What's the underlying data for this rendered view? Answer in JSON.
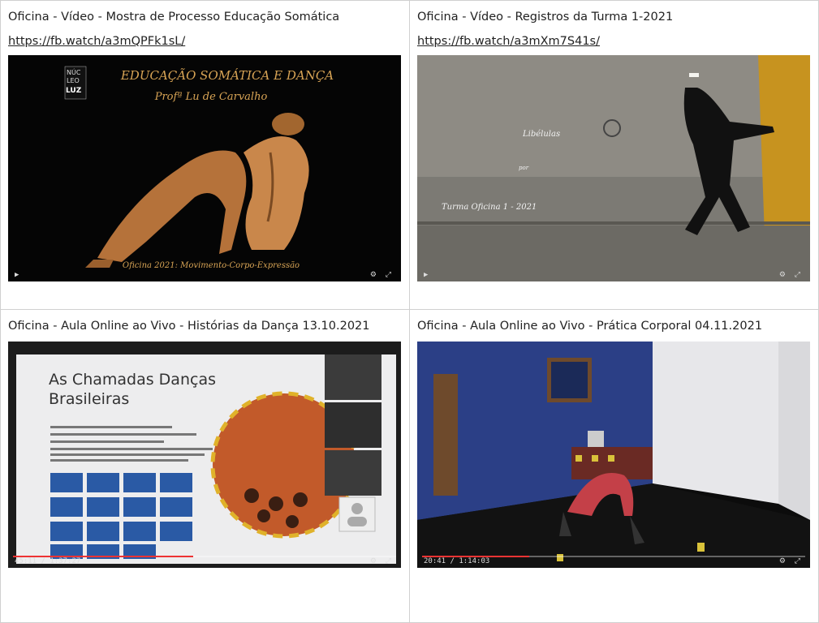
{
  "cells": [
    {
      "title": "Oficina - Vídeo - Mostra de Processo Educação Somática",
      "link": "https://fb.watch/a3mQPFk1sL/"
    },
    {
      "title": "Oficina - Vídeo - Registros da Turma 1-2021",
      "link": "https://fb.watch/a3mXm7S41s/"
    },
    {
      "title": "Oficina - Aula Online ao Vivo - Histórias da Dança 13.10.2021"
    },
    {
      "title": "Oficina - Aula Online ao Vivo - Prática Corporal 04.11.2021"
    }
  ],
  "thumb1": {
    "logo": [
      "NÚC",
      "LEO",
      "LUZ"
    ],
    "heading": "EDUCAÇÃO SOMÁTICA E DANÇA",
    "subheading": "Profª Lu de Carvalho",
    "footer": "Oficina 2021: Movimento-Corpo-Expressão"
  },
  "thumb2": {
    "line1": "Libélulas",
    "line2": "por",
    "line3": "Turma Oficina 1 - 2021"
  },
  "thumb3": {
    "slide_title": "As Chamadas Danças Brasileiras",
    "time": "45:11 / 1:37:27"
  },
  "thumb4": {
    "time": "20:41 / 1:14:03"
  },
  "progress": {
    "thumb3": 0.47,
    "thumb4": 0.28
  },
  "colors": {
    "logo_gold": "#d8a455",
    "link_dark": "#222222",
    "accent_red": "#e33333"
  }
}
